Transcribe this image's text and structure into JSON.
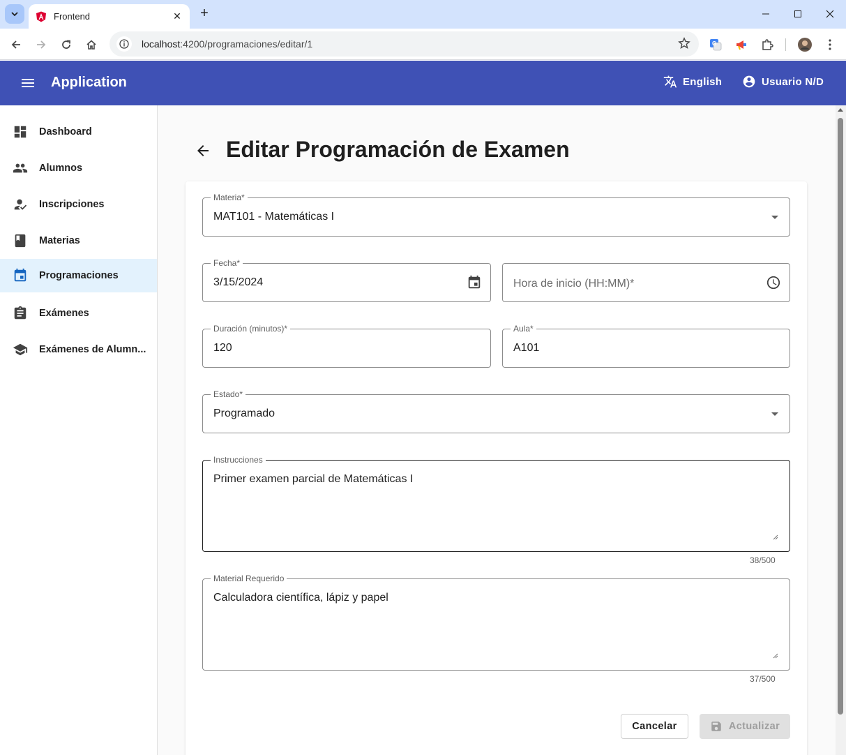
{
  "browser": {
    "tab_title": "Frontend",
    "url_host": "localhost",
    "url_rest": ":4200/programaciones/editar/1"
  },
  "app": {
    "title": "Application",
    "language_label": "English",
    "user_label": "Usuario N/D"
  },
  "sidebar": {
    "items": [
      {
        "label": "Dashboard",
        "icon": "dashboard-icon"
      },
      {
        "label": "Alumnos",
        "icon": "people-icon"
      },
      {
        "label": "Inscripciones",
        "icon": "how-to-reg-icon"
      },
      {
        "label": "Materias",
        "icon": "book-icon"
      },
      {
        "label": "Programaciones",
        "icon": "calendar-icon",
        "active": true
      },
      {
        "label": "Exámenes",
        "icon": "assignment-icon"
      },
      {
        "label": "Exámenes de Alumn...",
        "icon": "school-icon"
      }
    ]
  },
  "page": {
    "title": "Editar Programación de Examen"
  },
  "form": {
    "materia": {
      "label": "Materia*",
      "value": "MAT101 - Matemáticas I"
    },
    "fecha": {
      "label": "Fecha*",
      "value": "3/15/2024"
    },
    "hora": {
      "placeholder": "Hora de inicio (HH:MM)*"
    },
    "duracion": {
      "label": "Duración (minutos)*",
      "value": "120"
    },
    "aula": {
      "label": "Aula*",
      "value": "A101"
    },
    "estado": {
      "label": "Estado*",
      "value": "Programado"
    },
    "instrucciones": {
      "label": "Instrucciones",
      "value": "Primer examen parcial de Matemáticas I",
      "counter": "38/500"
    },
    "material": {
      "label": "Material Requerido",
      "value": "Calculadora científica, lápiz y papel",
      "counter": "37/500"
    },
    "cancel_label": "Cancelar",
    "update_label": "Actualizar"
  },
  "colors": {
    "toolbar": "#3f51b5",
    "active_nav": "#e3f2fd"
  }
}
